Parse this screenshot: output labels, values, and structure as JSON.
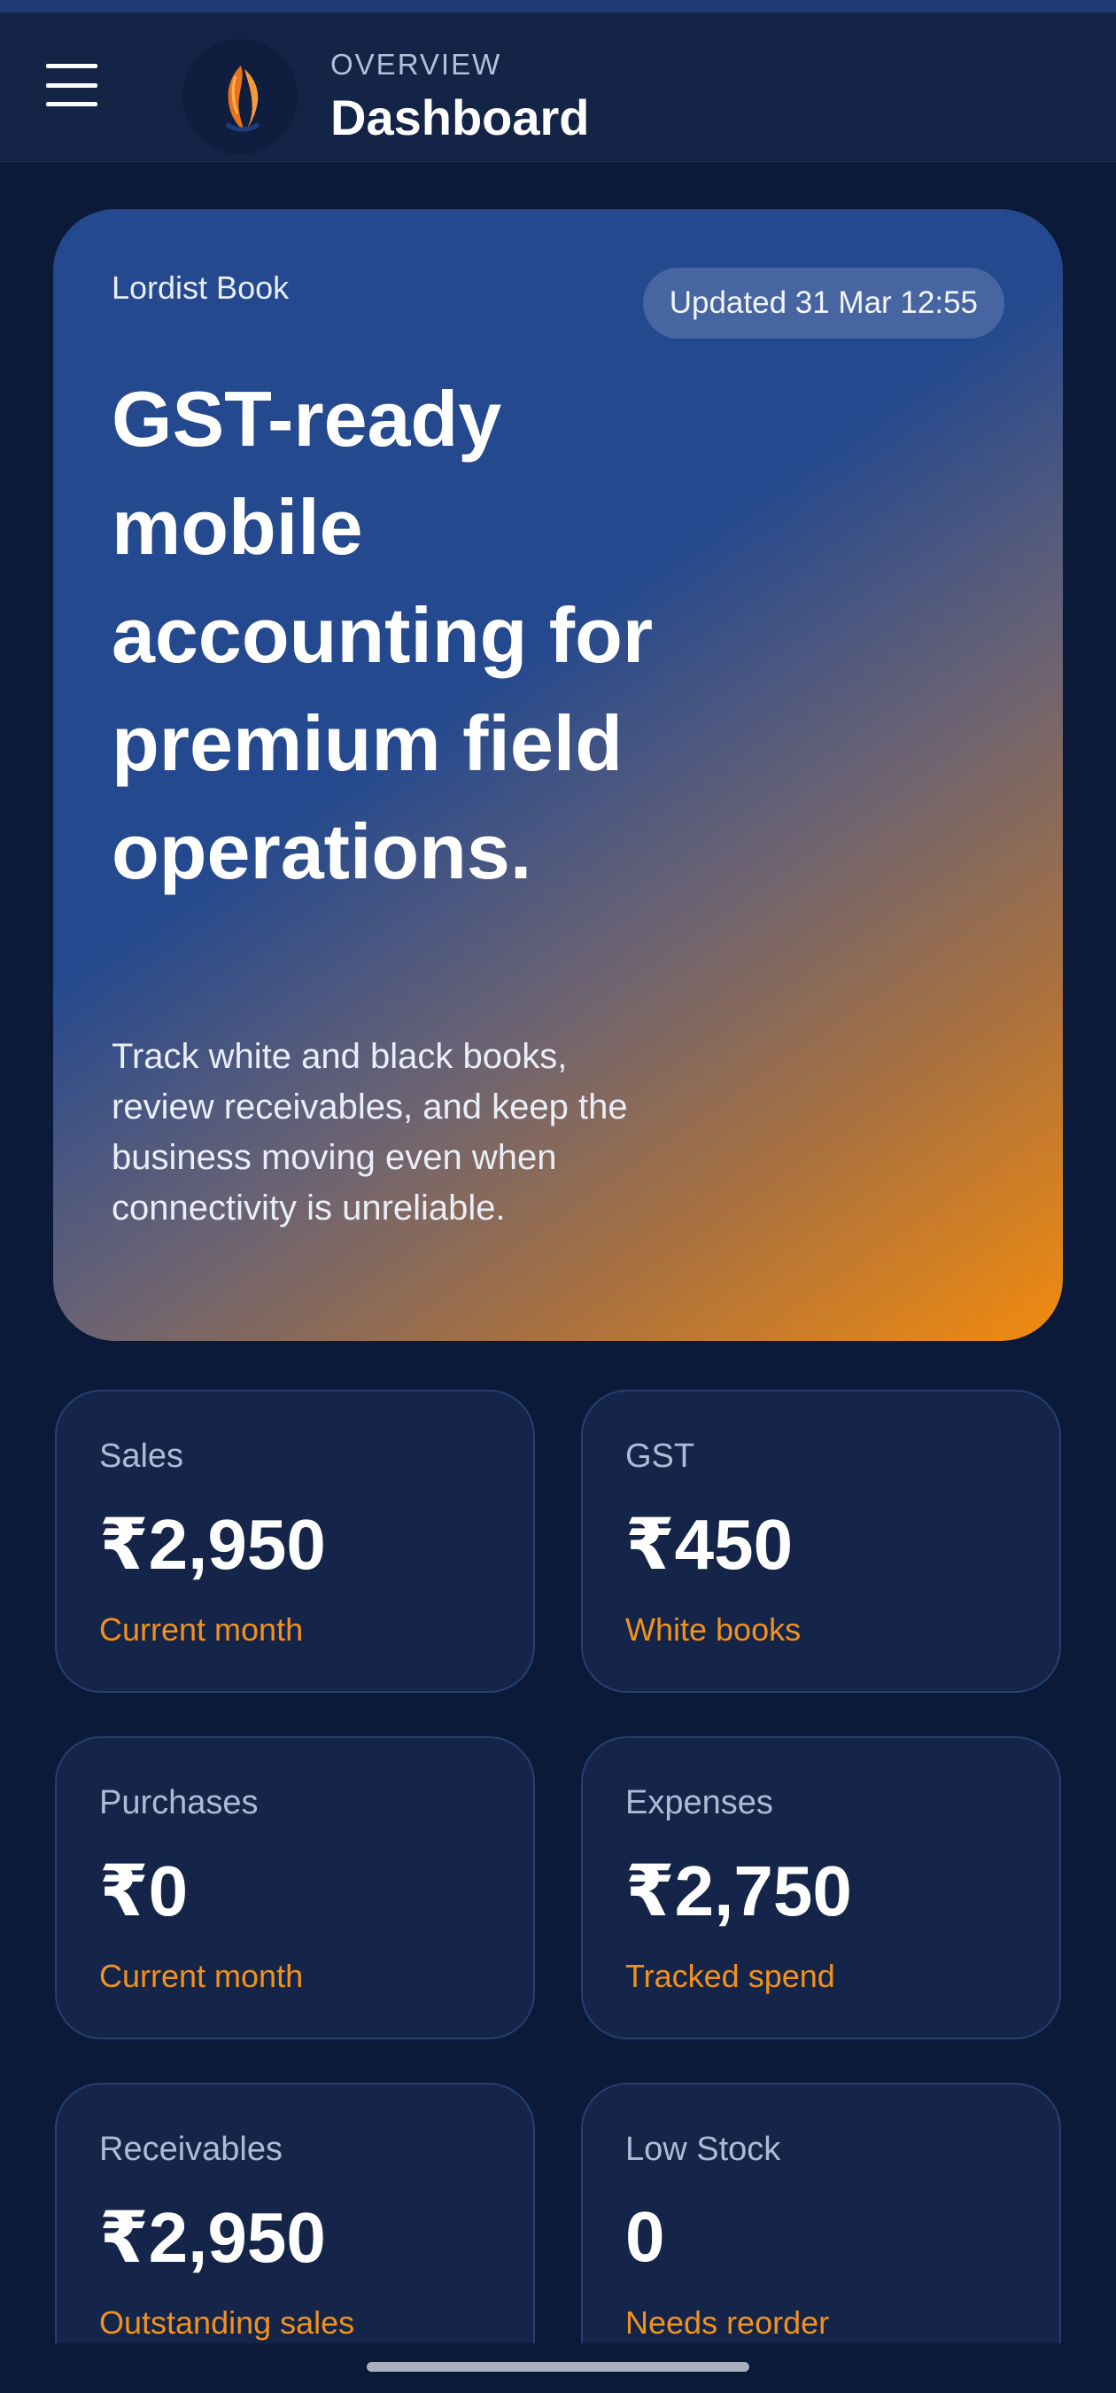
{
  "header": {
    "eyebrow": "OVERVIEW",
    "title": "Dashboard",
    "menu_icon": "hamburger-menu-icon",
    "logo_icon": "shell-logo-icon"
  },
  "hero": {
    "brand": "Lordist Book",
    "badge": "Updated 31 Mar 12:55",
    "headline": "GST-ready mobile accounting for premium field operations.",
    "body": "Track white and black books, review receivables, and keep the business moving even when connectivity is unreliable."
  },
  "stats": [
    {
      "label": "Sales",
      "value": "₹2,950",
      "sub": "Current month"
    },
    {
      "label": "GST",
      "value": "₹450",
      "sub": "White books"
    },
    {
      "label": "Purchases",
      "value": "₹0",
      "sub": "Current month"
    },
    {
      "label": "Expenses",
      "value": "₹2,750",
      "sub": "Tracked spend"
    },
    {
      "label": "Receivables",
      "value": "₹2,950",
      "sub": "Outstanding sales"
    },
    {
      "label": "Low Stock",
      "value": "0",
      "sub": "Needs reorder"
    }
  ],
  "colors": {
    "background": "#0b1a39",
    "card": "#142549",
    "accent": "#f2921d",
    "hero_start": "#24498f",
    "hero_end": "#f38b0e"
  }
}
